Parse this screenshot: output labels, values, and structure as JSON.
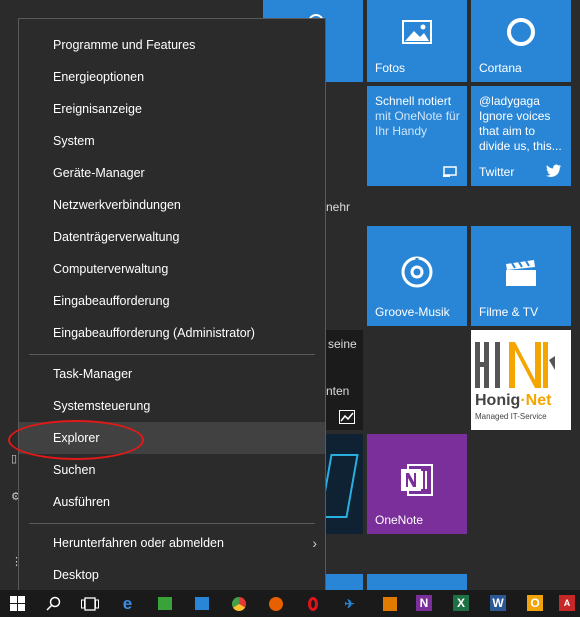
{
  "menu": {
    "items": [
      "Programme und Features",
      "Energieoptionen",
      "Ereignisanzeige",
      "System",
      "Geräte-Manager",
      "Netzwerkverbindungen",
      "Datenträgerverwaltung",
      "Computerverwaltung",
      "Eingabeaufforderung",
      "Eingabeaufforderung (Administrator)"
    ],
    "group2": [
      "Task-Manager",
      "Systemsteuerung",
      "Explorer",
      "Suchen",
      "Ausführen"
    ],
    "group3": [
      "Herunterfahren oder abmelden",
      "Desktop"
    ],
    "highlighted": "Explorer"
  },
  "tiles": {
    "fotos": "Fotos",
    "cortana": "Cortana",
    "onenote_note_title": "Schnell notiert",
    "onenote_note_body": "mit OneNote für Ihr Handy",
    "twitter_body": "@ladygaga Ignore voices that aim to divide us, this...",
    "twitter": "Twitter",
    "groove": "Groove-Musik",
    "filme": "Filme & TV",
    "onenote": "OneNote",
    "honig_brand_1": "Honig",
    "honig_brand_2": "Net",
    "honig_sub": "Managed IT-Service"
  },
  "behind": {
    "mehr": "nehr",
    "seine": "seine",
    "nten": "nten"
  },
  "colors": {
    "tile_blue": "#2986d6",
    "tile_purple": "#7b2f9b",
    "menu_bg": "#2b2b2b",
    "highlight": "#414141",
    "annotation_red": "#e11919"
  },
  "taskbar_icons": [
    "windows-start-icon",
    "search-icon",
    "task-view-icon",
    "edge-icon",
    "store-icon",
    "photos-icon",
    "chrome-icon",
    "firefox-icon",
    "opera-icon",
    "app-icon",
    "app2-icon",
    "onenote-icon",
    "excel-icon",
    "word-icon",
    "outlook-icon",
    "pdf-icon"
  ]
}
